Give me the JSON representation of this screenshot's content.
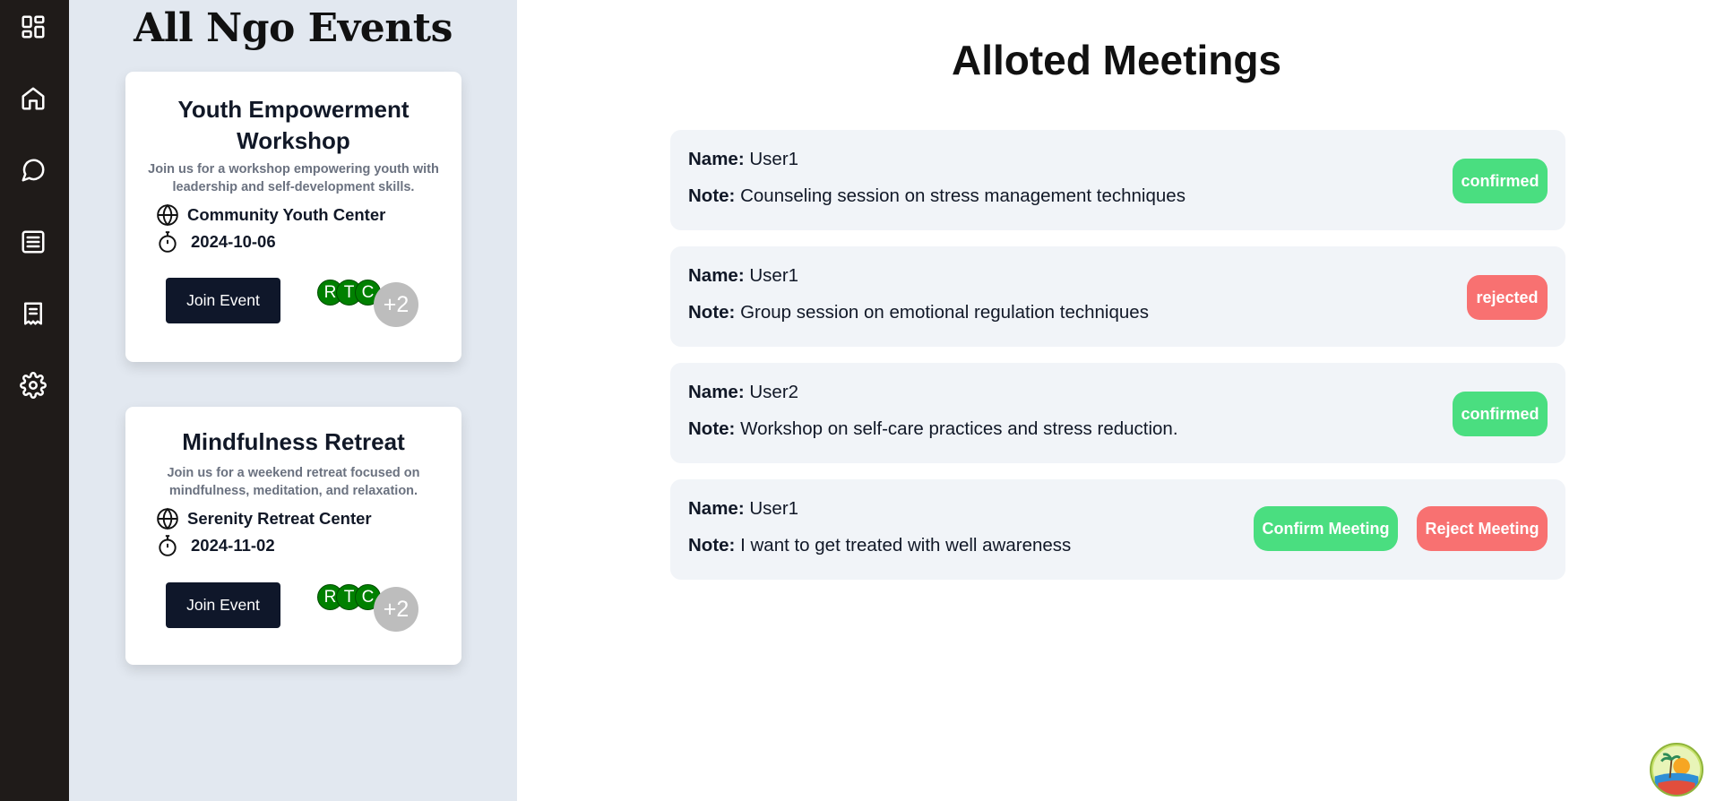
{
  "nav": {
    "items": [
      {
        "icon": "dashboard-icon"
      },
      {
        "icon": "home-icon"
      },
      {
        "icon": "chat-icon"
      },
      {
        "icon": "list-icon"
      },
      {
        "icon": "document-icon"
      },
      {
        "icon": "settings-icon"
      }
    ]
  },
  "events_panel": {
    "title": "All Ngo Events",
    "events": [
      {
        "name": "Youth Empowerment Workshop",
        "description": "Join us for a workshop empowering youth with leadership and self-development skills.",
        "location": "Community Youth Center",
        "date": "2024-10-06",
        "join_label": "Join Event",
        "avatars": [
          "R",
          "T",
          "C"
        ],
        "more_count": "+2"
      },
      {
        "name": "Mindfulness Retreat",
        "description": "Join us for a weekend retreat focused on mindfulness, meditation, and relaxation.",
        "location": "Serenity Retreat Center",
        "date": "2024-11-02",
        "join_label": "Join Event",
        "avatars": [
          "R",
          "T",
          "C"
        ],
        "more_count": "+2"
      }
    ]
  },
  "main": {
    "title": "Alloted Meetings",
    "name_label": "Name:",
    "note_label": "Note:",
    "meetings": [
      {
        "name": "User1",
        "note": "Counseling session on stress management techniques",
        "status": "confirmed"
      },
      {
        "name": "User1",
        "note": "Group session on emotional regulation techniques",
        "status": "rejected"
      },
      {
        "name": "User2",
        "note": "Workshop on self-care practices and stress reduction.",
        "status": "confirmed"
      },
      {
        "name": "User1",
        "note": "I want to get treated with well awareness",
        "confirm_label": "Confirm Meeting",
        "reject_label": "Reject Meeting"
      }
    ]
  },
  "colors": {
    "rail": "#1f1b19",
    "panel": "#e2e8f0",
    "confirmed": "#4ade80",
    "rejected": "#f87171",
    "button_dark": "#0f172a",
    "avatar": "#008000"
  }
}
